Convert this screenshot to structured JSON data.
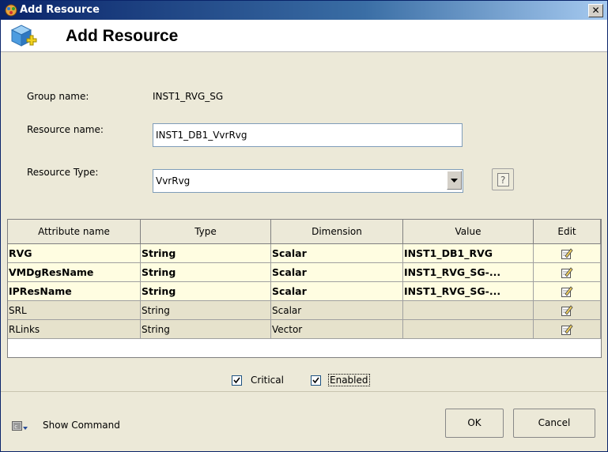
{
  "window": {
    "title": "Add Resource",
    "close_label": "✕"
  },
  "header": {
    "title": "Add Resource",
    "icon": "cube-add-icon"
  },
  "form": {
    "group_label": "Group name:",
    "group_value": "INST1_RVG_SG",
    "resource_name_label": "Resource name:",
    "resource_name_value": "INST1_DB1_VvrRvg",
    "resource_type_label": "Resource Type:",
    "resource_type_value": "VvrRvg"
  },
  "table": {
    "columns": [
      "Attribute name",
      "Type",
      "Dimension",
      "Value",
      "Edit"
    ],
    "rows": [
      {
        "name": "RVG",
        "type": "String",
        "dimension": "Scalar",
        "value": "INST1_DB1_RVG",
        "required": true
      },
      {
        "name": "VMDgResName",
        "type": "String",
        "dimension": "Scalar",
        "value": "INST1_RVG_SG-...",
        "required": true
      },
      {
        "name": "IPResName",
        "type": "String",
        "dimension": "Scalar",
        "value": "INST1_RVG_SG-...",
        "required": true
      },
      {
        "name": "SRL",
        "type": "String",
        "dimension": "Scalar",
        "value": "",
        "required": false
      },
      {
        "name": "RLinks",
        "type": "String",
        "dimension": "Vector",
        "value": "",
        "required": false
      }
    ]
  },
  "options": {
    "critical_label": "Critical",
    "critical_checked": true,
    "enabled_label": "Enabled",
    "enabled_checked": true
  },
  "footer": {
    "show_command_label": "Show Command",
    "ok_label": "OK",
    "cancel_label": "Cancel"
  },
  "colors": {
    "title_bar": "#0a246a",
    "required_row": "#fffde1",
    "optional_row": "#e6e2cc",
    "dialog_bg": "#ece9d8"
  }
}
